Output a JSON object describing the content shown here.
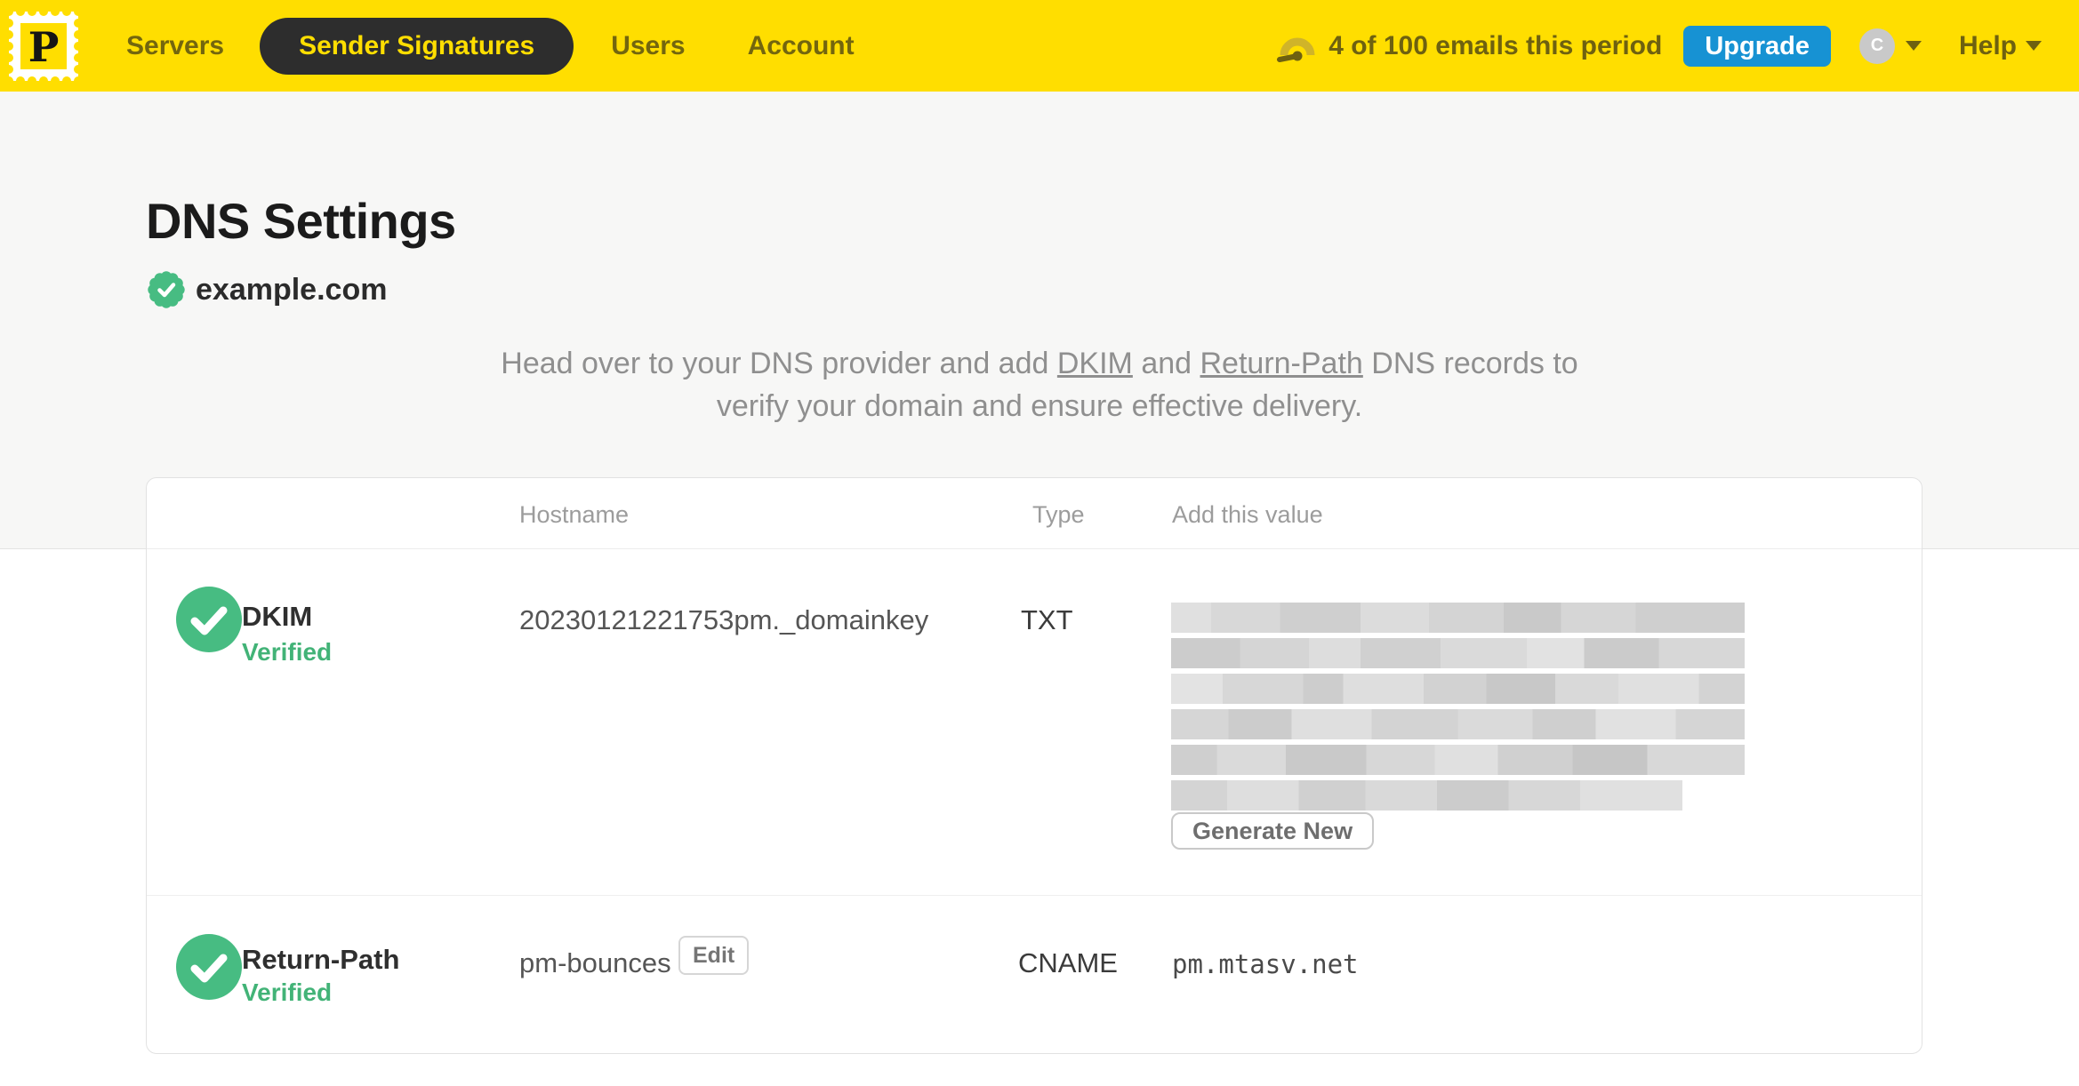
{
  "nav": {
    "logo": {
      "letter": "P",
      "icon": "postmark-stamp-logo"
    },
    "items": [
      {
        "label": "Servers",
        "active": false
      },
      {
        "label": "Sender Signatures",
        "active": true
      },
      {
        "label": "Users",
        "active": false
      },
      {
        "label": "Account",
        "active": false
      }
    ],
    "usage": {
      "icon": "gauge-icon",
      "text": "4 of 100 emails this period"
    },
    "upgrade_label": "Upgrade",
    "account_menu": {
      "avatar_initial": "C",
      "caret_icon": "caret-down-icon"
    },
    "help": {
      "label": "Help",
      "caret_icon": "caret-down-icon"
    }
  },
  "page": {
    "title": "DNS Settings",
    "domain": {
      "name": "example.com",
      "status_icon": "verified-seal-icon"
    },
    "description": {
      "part1": "Head over to your DNS provider and add ",
      "link_dkim": "DKIM",
      "part2": " and ",
      "link_return_path": "Return-Path",
      "part3": " DNS records to",
      "line2": "verify your domain and ensure effective delivery."
    }
  },
  "table": {
    "headers": {
      "hostname": "Hostname",
      "type": "Type",
      "value": "Add this value"
    },
    "rows": [
      {
        "name": "DKIM",
        "status": "Verified",
        "status_icon": "check-circle-icon",
        "hostname": "20230121221753pm._domainkey",
        "type": "TXT",
        "value_redacted": true,
        "action_label": "Generate New"
      },
      {
        "name": "Return-Path",
        "status": "Verified",
        "status_icon": "check-circle-icon",
        "hostname": "pm-bounces",
        "edit_label": "Edit",
        "type": "CNAME",
        "value": "pm.mtasv.net"
      }
    ]
  },
  "colors": {
    "brand_yellow": "#FFDE00",
    "nav_text_olive": "#73660e",
    "active_pill_bg": "#2d2d2d",
    "upgrade_blue": "#1792d3",
    "verified_green": "#47bc82",
    "page_bg_gray": "#f7f7f6"
  }
}
